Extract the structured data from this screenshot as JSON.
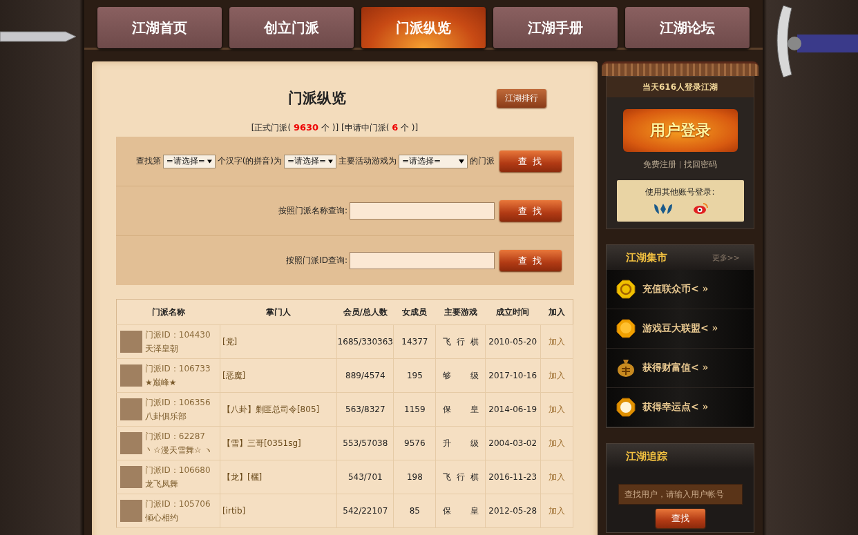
{
  "nav": {
    "tabs": [
      {
        "label": "江湖首页",
        "selected": false
      },
      {
        "label": "创立门派",
        "selected": false
      },
      {
        "label": "门派纵览",
        "selected": true
      },
      {
        "label": "江湖手册",
        "selected": false
      },
      {
        "label": "江湖论坛",
        "selected": false
      }
    ]
  },
  "main": {
    "title": "门派纵览",
    "ranking_button": "江湖排行",
    "stats": "[正式门派( **9630** 个 )] [申请中门派( **6** 个 )]",
    "filter": {
      "parts": [
        {
          "kind": "text",
          "text": "查找第"
        },
        {
          "kind": "select",
          "value": "=请选择="
        },
        {
          "kind": "text",
          "text": "个汉字(的拼音)为"
        },
        {
          "kind": "select",
          "value": "=请选择="
        },
        {
          "kind": "text",
          "text": "主要活动游戏为"
        },
        {
          "kind": "wide-select",
          "value": "=请选择="
        },
        {
          "kind": "text",
          "text": "的门派"
        }
      ],
      "button": "查 找"
    },
    "name_search": {
      "label": "按照门派名称查询:",
      "button": "查 找"
    },
    "id_search": {
      "label": "按照门派ID查询:",
      "button": "查 找"
    },
    "table": {
      "columns": [
        "门派名称",
        "掌门人",
        "会员/总人数",
        "女成员",
        "主要游戏",
        "成立时间",
        "加入"
      ],
      "rows": [
        {
          "id": "门派ID：104430",
          "name": "天泽皇朝",
          "leader": "[党]",
          "members": "1685/330363",
          "female": "14377",
          "game": "飞行棋",
          "founded": "2010-05-20",
          "join": "加入"
        },
        {
          "id": "门派ID：106733",
          "name": "★巅峰★",
          "leader": "[恶魔]",
          "members": "889/4574",
          "female": "195",
          "game": "够级",
          "founded": "2017-10-16",
          "join": "加入"
        },
        {
          "id": "门派ID：106356",
          "name": "八卦俱乐部",
          "leader": "【八卦】剿匪总司令[805]",
          "members": "563/8327",
          "female": "1159",
          "game": "保皇",
          "founded": "2014-06-19",
          "join": "加入"
        },
        {
          "id": "门派ID：62287",
          "name": "丶☆漫天雪舞☆ ヽ",
          "leader": "【雪】三哥[0351sg]",
          "members": "553/57038",
          "female": "9576",
          "game": "升级",
          "founded": "2004-03-02",
          "join": "加入"
        },
        {
          "id": "门派ID：106680",
          "name": "龙飞凤舞",
          "leader": "【龙】[欐]",
          "members": "543/701",
          "female": "198",
          "game": "飞行棋",
          "founded": "2016-11-23",
          "join": "加入"
        },
        {
          "id": "门派ID：105706",
          "name": "倾心相约",
          "leader": "[irtib]",
          "members": "542/22107",
          "female": "85",
          "game": "保皇",
          "founded": "2012-05-28",
          "join": "加入"
        }
      ]
    }
  },
  "sidebar": {
    "online": "当天616人登录江湖",
    "login_button": "用户登录",
    "register_link": "免费注册",
    "recover_link": "找回密码",
    "other_login": "使用其他账号登录:",
    "market": {
      "title": "江湖集市",
      "more": "更多>>",
      "items": [
        {
          "kind": "coin",
          "label": "充值联众币< »"
        },
        {
          "kind": "bean",
          "label": "游戏豆大联盟< »"
        },
        {
          "kind": "bag",
          "label": "获得财富值< »"
        },
        {
          "kind": "pearl",
          "label": "获得幸运点< »"
        }
      ]
    },
    "tracking": {
      "title": "江湖追踪",
      "placeholder": "查找用户，请输入用户帐号",
      "button": "查找"
    }
  }
}
